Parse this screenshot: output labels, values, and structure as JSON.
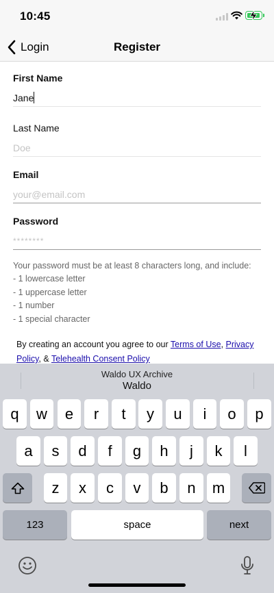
{
  "status_bar": {
    "time": "10:45"
  },
  "nav": {
    "back_label": "Login",
    "title": "Register"
  },
  "form": {
    "first_name": {
      "label": "First Name",
      "value": "Jane"
    },
    "last_name": {
      "label": "Last Name",
      "placeholder": "Doe"
    },
    "email": {
      "label": "Email",
      "placeholder": "your@email.com"
    },
    "password": {
      "label": "Password",
      "placeholder": "********"
    }
  },
  "password_help": {
    "intro": "Your password must be at least 8 characters long, and include:",
    "rules": [
      "- 1 lowercase letter",
      "- 1 uppercase letter",
      "- 1 number",
      "- 1 special character"
    ]
  },
  "legal": {
    "prefix": "By creating an account you agree to our ",
    "terms": "Terms of Use",
    "sep1": ", ",
    "privacy": "Privacy Policy",
    "sep2": ", & ",
    "telehealth": "Telehealth Consent Policy"
  },
  "keyboard": {
    "suggestion_top": "Waldo UX Archive",
    "suggestion_main": "Waldo",
    "row1": [
      "q",
      "w",
      "e",
      "r",
      "t",
      "y",
      "u",
      "i",
      "o",
      "p"
    ],
    "row2": [
      "a",
      "s",
      "d",
      "f",
      "g",
      "h",
      "j",
      "k",
      "l"
    ],
    "row3": [
      "z",
      "x",
      "c",
      "v",
      "b",
      "n",
      "m"
    ],
    "numbers_label": "123",
    "space_label": "space",
    "return_label": "next"
  },
  "colors": {
    "battery": "#34c759",
    "link": "#1a0dab",
    "keyboard_bg": "#d1d3d9"
  }
}
